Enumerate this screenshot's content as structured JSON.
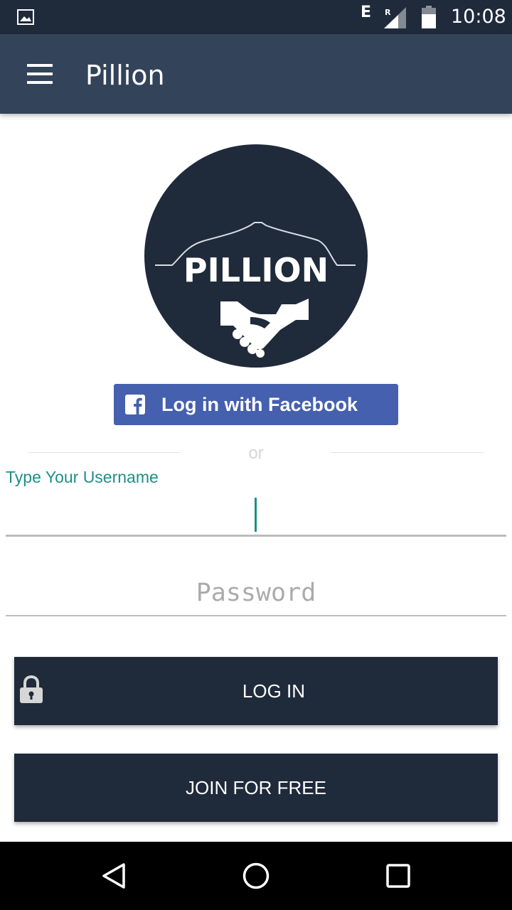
{
  "status_bar": {
    "network_type": "E",
    "roaming_indicator": "R",
    "time": "10:08",
    "icons": [
      "gallery-icon",
      "signal-icon",
      "battery-icon"
    ]
  },
  "app_bar": {
    "title": "Pillion",
    "menu_icon": "hamburger-menu-icon",
    "color": "#334359"
  },
  "logo": {
    "text": "PILLION",
    "color": "#1f2a3b"
  },
  "facebook": {
    "label": "Log in with Facebook",
    "icon": "facebook-icon",
    "color": "#4460ae"
  },
  "divider": {
    "text": "or"
  },
  "username": {
    "label": "Type Your Username",
    "value": "",
    "accent": "#1f8f86"
  },
  "password": {
    "placeholder": "Password",
    "value": ""
  },
  "buttons": {
    "login_label": "LOG IN",
    "login_icon": "lock-icon",
    "join_label": "JOIN FOR FREE",
    "color": "#1f2a3b"
  },
  "nav_bar": {
    "icons": [
      "back-icon",
      "home-icon",
      "recents-icon"
    ]
  }
}
